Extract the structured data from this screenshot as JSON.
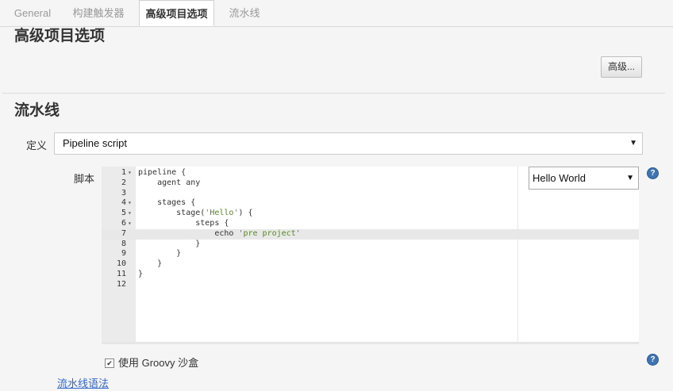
{
  "tabs": [
    {
      "label": "General",
      "active": false
    },
    {
      "label": "构建触发器",
      "active": false
    },
    {
      "label": "高级项目选项",
      "active": true
    },
    {
      "label": "流水线",
      "active": false
    }
  ],
  "advanced_section": {
    "title": "高级项目选项",
    "button_label": "高级..."
  },
  "pipeline_section": {
    "title": "流水线",
    "definition_label": "定义",
    "definition_value": "Pipeline script",
    "script_label": "脚本",
    "sample_value": "Hello World",
    "code_lines": [
      {
        "n": "1",
        "fold": true,
        "text": "pipeline {"
      },
      {
        "n": "2",
        "fold": false,
        "text": "    agent any"
      },
      {
        "n": "3",
        "fold": false,
        "text": ""
      },
      {
        "n": "4",
        "fold": true,
        "text": "    stages {"
      },
      {
        "n": "5",
        "fold": true,
        "text": "        stage('Hello') {"
      },
      {
        "n": "6",
        "fold": true,
        "text": "            steps {"
      },
      {
        "n": "7",
        "fold": false,
        "text": "                echo 'pre project'"
      },
      {
        "n": "8",
        "fold": false,
        "text": "            }"
      },
      {
        "n": "9",
        "fold": false,
        "text": "        }"
      },
      {
        "n": "10",
        "fold": false,
        "text": "    }"
      },
      {
        "n": "11",
        "fold": false,
        "text": "}"
      },
      {
        "n": "12",
        "fold": false,
        "text": ""
      }
    ],
    "current_line": 7,
    "groovy_sandbox_label": "使用 Groovy 沙盒",
    "groovy_sandbox_checked": true,
    "syntax_link": "流水线语法"
  },
  "icons": {
    "help": "?",
    "checkmark": "✔",
    "dropdown": "▼"
  }
}
